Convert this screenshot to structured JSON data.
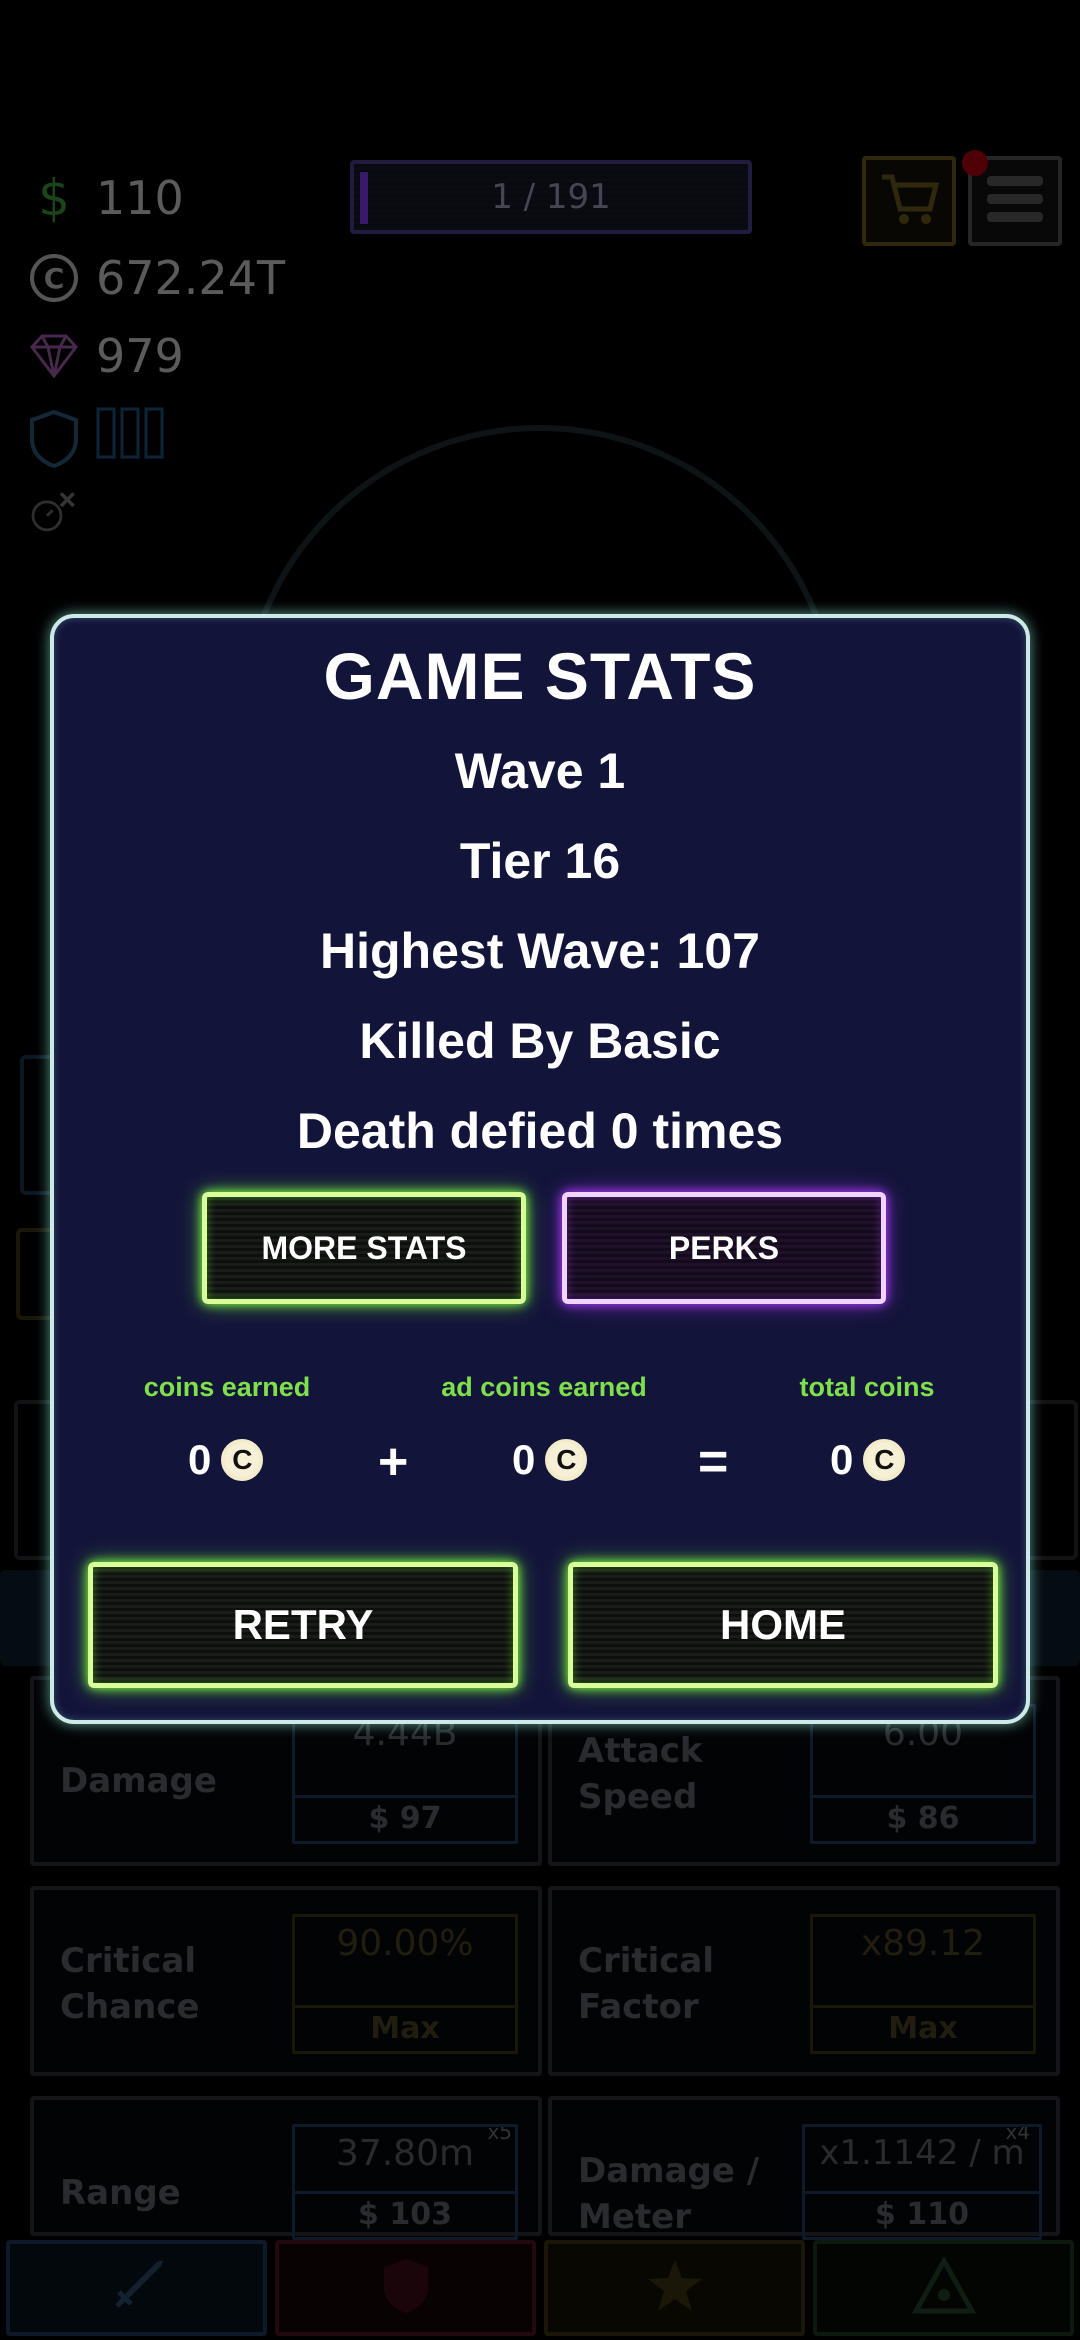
{
  "resources": {
    "cash": "110",
    "coins": "672.24T",
    "gems": "979"
  },
  "wave_progress": "1 / 191",
  "modal": {
    "title": "GAME STATS",
    "wave": "Wave 1",
    "tier": "Tier 16",
    "highest_wave": "Highest Wave: 107",
    "killed_by": "Killed By Basic",
    "death_defied": "Death defied 0 times",
    "more_stats_label": "MORE STATS",
    "perks_label": "PERKS",
    "coins": {
      "earned_label": "coins earned",
      "ad_label": "ad coins earned",
      "total_label": "total coins",
      "earned_value": "0",
      "ad_value": "0",
      "total_value": "0",
      "plus": "+",
      "equals": "=",
      "coin_symbol": "C"
    },
    "retry_label": "RETRY",
    "home_label": "HOME"
  },
  "upgrades": [
    {
      "label": "Damage",
      "value": "4.44B",
      "cost": "$ 97",
      "mult": ""
    },
    {
      "label": "Attack Speed",
      "value": "6.00",
      "cost": "$ 86",
      "mult": ""
    },
    {
      "label": "Critical Chance",
      "value": "90.00%",
      "cost": "Max",
      "mult": ""
    },
    {
      "label": "Critical Factor",
      "value": "x89.12",
      "cost": "Max",
      "mult": ""
    },
    {
      "label": "Range",
      "value": "37.80m",
      "cost": "$ 103",
      "mult": "x5"
    },
    {
      "label": "Damage / Meter",
      "value": "x1.1142 / m",
      "cost": "$ 110",
      "mult": "x4"
    }
  ],
  "tabs": [
    "attack-tab",
    "defense-tab",
    "utility-tab",
    "ultimate-tab"
  ],
  "colors": {
    "modal_bg": "#13143a",
    "neon_green": "#7dff3a",
    "neon_purple": "#b23aff",
    "coin_label_green": "#7ee04a"
  }
}
